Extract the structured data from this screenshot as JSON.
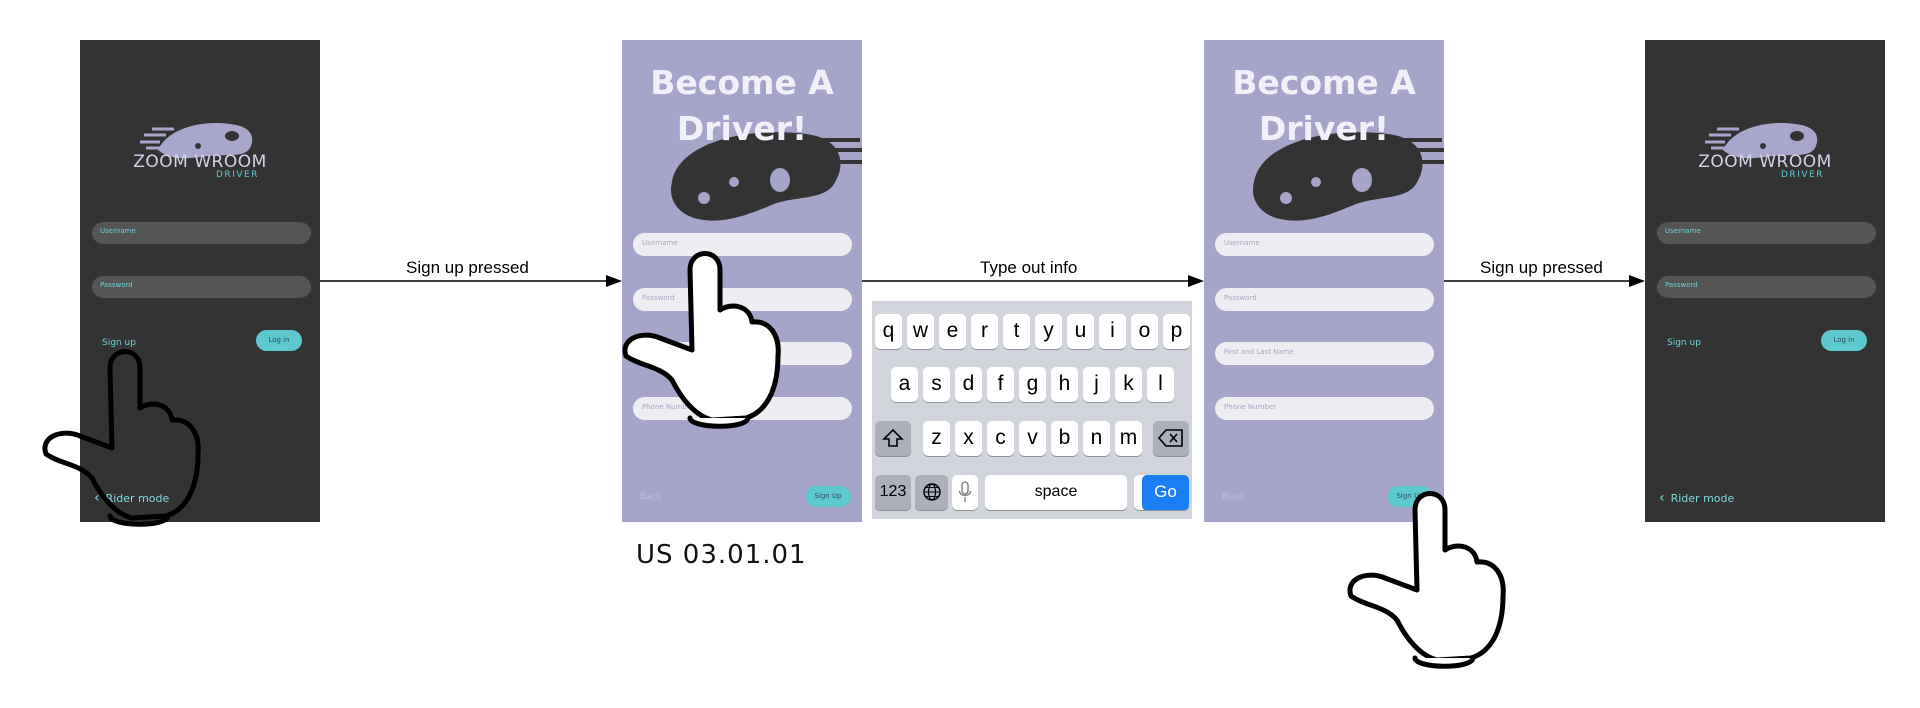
{
  "transitions": [
    {
      "label": "Sign up pressed"
    },
    {
      "label": "Type out info"
    },
    {
      "label": "Sign up pressed"
    }
  ],
  "login_screen": {
    "brand": "ZOOM WROOM",
    "sub": "DRIVER",
    "username_placeholder": "Username",
    "password_placeholder": "Password",
    "signup_link": "Sign up",
    "login_button": "Log in",
    "rider_mode": "Rider mode"
  },
  "signup_screen": {
    "title_line1": "Become A",
    "title_line2": "Driver!",
    "username_placeholder": "Username",
    "password_placeholder": "Password",
    "name_placeholder": "First and Last Name",
    "phone_placeholder": "Phone Number",
    "back": "Back",
    "signup_button": "Sign Up"
  },
  "keyboard": {
    "row1": [
      "q",
      "w",
      "e",
      "r",
      "t",
      "y",
      "u",
      "i",
      "o",
      "p"
    ],
    "row2": [
      "a",
      "s",
      "d",
      "f",
      "g",
      "h",
      "j",
      "k",
      "l"
    ],
    "row3": [
      "z",
      "x",
      "c",
      "v",
      "b",
      "n",
      "m"
    ],
    "numbers": "123",
    "space": "space",
    "period": ".",
    "go": "Go"
  },
  "caption": "US 03.01.01",
  "colors": {
    "dark_screen": "#333333",
    "purple_screen": "#a6a5c9",
    "accent_teal": "#5ec8cf",
    "keyboard_go": "#1a7ff6"
  }
}
